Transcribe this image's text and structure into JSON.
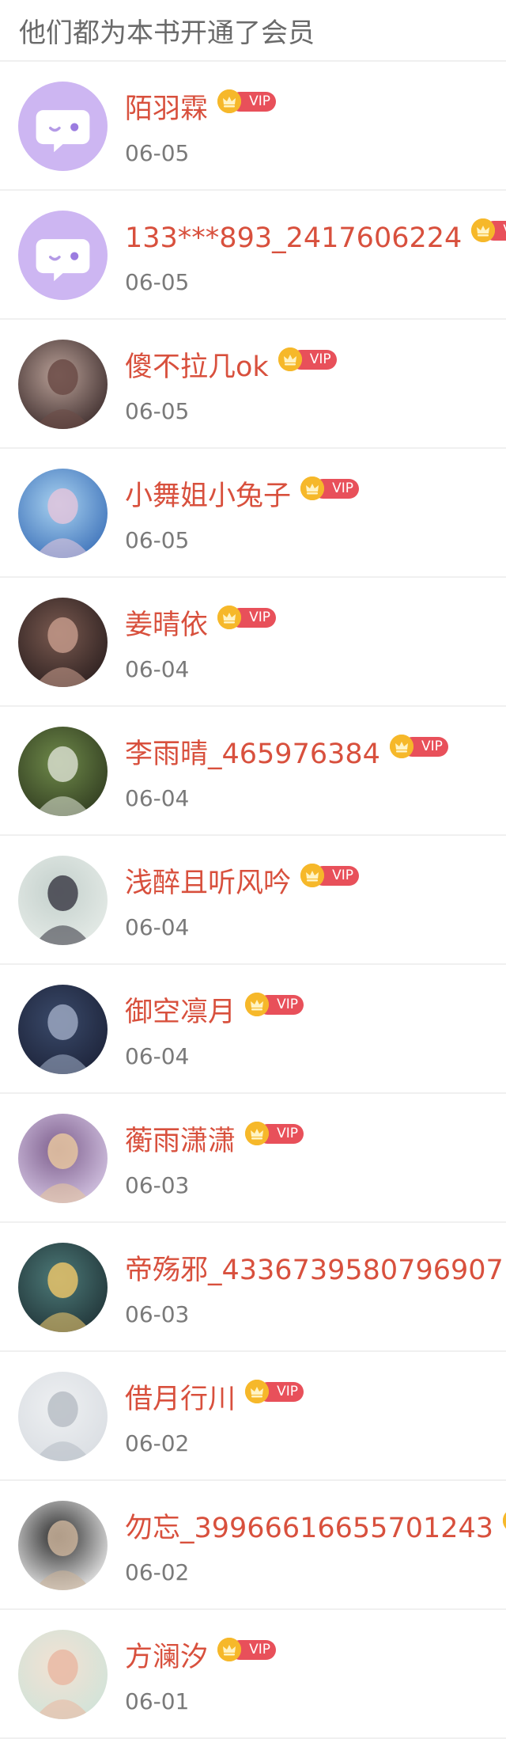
{
  "header": {
    "title": "他们都为本书开通了会员"
  },
  "vip_label": "VIP",
  "colors": {
    "name": "#d8503d",
    "vip_pill": "#e8505a",
    "crown": "#f6b82a",
    "date": "#7a7a7a",
    "header_text": "#6a6a6a"
  },
  "members": [
    {
      "name": "陌羽霖",
      "date": "06-05",
      "avatar": "default-avatar-icon"
    },
    {
      "name": "133***893_2417606224",
      "date": "06-05",
      "avatar": "default-avatar-icon"
    },
    {
      "name": "傻不拉几ok",
      "date": "06-05",
      "avatar": "user-photo"
    },
    {
      "name": "小舞姐小兔子",
      "date": "06-05",
      "avatar": "user-photo"
    },
    {
      "name": "姜晴依",
      "date": "06-04",
      "avatar": "user-photo"
    },
    {
      "name": "李雨晴_465976384",
      "date": "06-04",
      "avatar": "user-photo"
    },
    {
      "name": "浅醉且听风吟",
      "date": "06-04",
      "avatar": "user-photo"
    },
    {
      "name": "御空凛月",
      "date": "06-04",
      "avatar": "user-photo"
    },
    {
      "name": "蘅雨潇潇",
      "date": "06-03",
      "avatar": "user-photo"
    },
    {
      "name": "帝殇邪_4336739580796907",
      "date": "06-03",
      "avatar": "user-photo"
    },
    {
      "name": "借月行川",
      "date": "06-02",
      "avatar": "user-photo"
    },
    {
      "name": "勿忘_39966616655701243",
      "date": "06-02",
      "avatar": "user-photo"
    },
    {
      "name": "方澜汐",
      "date": "06-01",
      "avatar": "user-photo"
    }
  ]
}
